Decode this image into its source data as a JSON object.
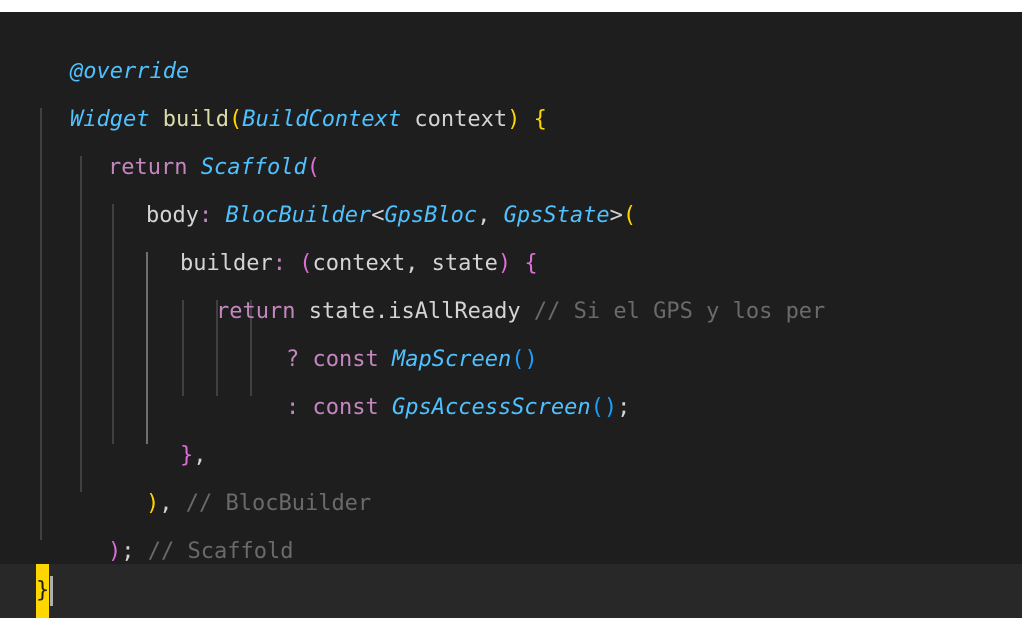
{
  "editor": {
    "theme": {
      "background": "#1e1e1e",
      "current_line": "#282828",
      "comment": "#6a6a6a",
      "bracket_gold": "#ffd700",
      "bracket_orchid": "#da70d6",
      "bracket_blue": "#179fff",
      "type": "#4fc1ff",
      "keyword": "#c586c0",
      "function": "#dcdcaa"
    },
    "lines": {
      "l1": {
        "annotation": "@override"
      },
      "l2": {
        "return_type": "Widget",
        "method": "build",
        "open_paren": "(",
        "param_type": "BuildContext",
        "param_name": " context",
        "close_paren": ")",
        "brace": " {"
      },
      "l3": {
        "keyword": "return",
        "class": "Scaffold",
        "open_paren": "("
      },
      "l4": {
        "prop": "body",
        "colon": ": ",
        "class": "BlocBuilder",
        "lt": "<",
        "generic1": "GpsBloc",
        "comma": ", ",
        "generic2": "GpsState",
        "gt": ">",
        "open_paren": "("
      },
      "l5": {
        "prop": "builder",
        "colon": ": ",
        "open_paren": "(",
        "params": "context, state",
        "close_paren": ")",
        "brace": " {"
      },
      "l6": {
        "keyword": "return",
        "expr": " state.isAllReady ",
        "comment": "// Si el GPS y los per"
      },
      "l7": {
        "op": "? ",
        "keyword": "const",
        "class": "MapScreen",
        "parens": "()"
      },
      "l8": {
        "op": ": ",
        "keyword": "const",
        "class": "GpsAccessScreen",
        "parens": "()",
        "semi": ";"
      },
      "l9": {
        "brace": "}",
        "comma": ","
      },
      "l10": {
        "paren": ")",
        "comma": ",",
        "comment": " // BlocBuilder"
      },
      "l11": {
        "paren": ")",
        "semi": ";",
        "comment": " // Scaffold"
      },
      "l12": {
        "brace": "}"
      },
      "l13": {
        "brace": "}"
      }
    }
  }
}
